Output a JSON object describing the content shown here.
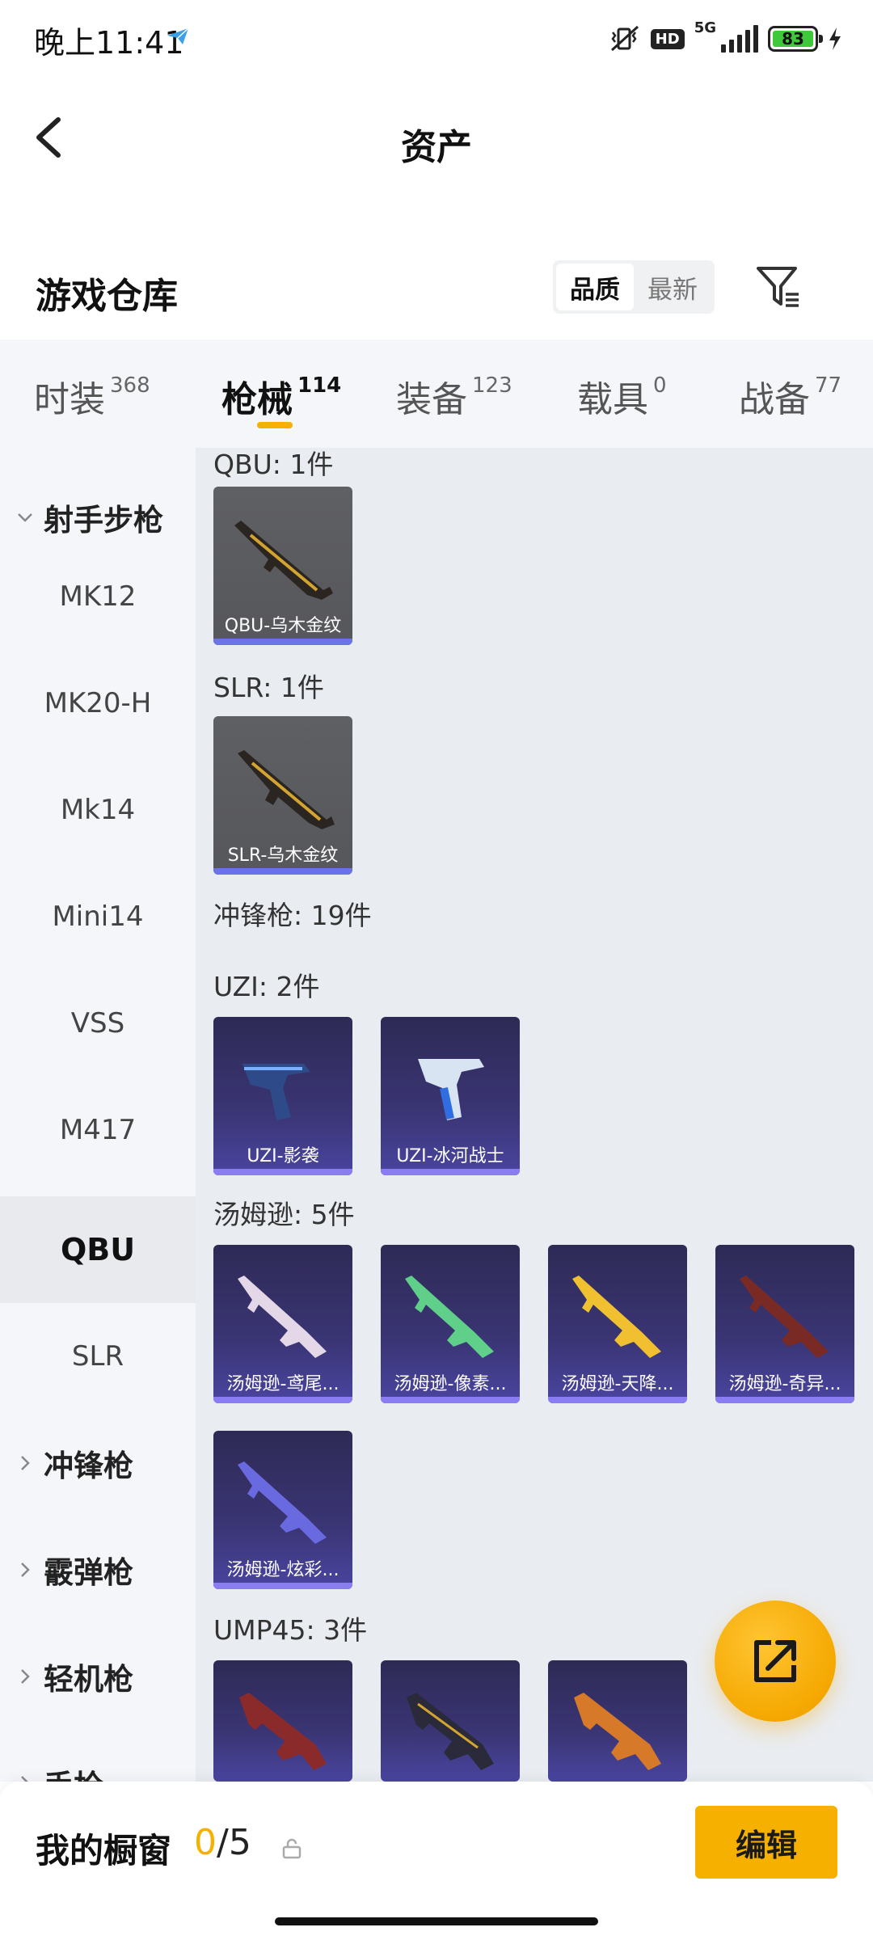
{
  "status": {
    "time": "晚上11:41",
    "hd": "HD",
    "network": "5G",
    "battery": "83"
  },
  "header": {
    "title": "资产"
  },
  "warehouse": {
    "title": "游戏仓库",
    "sort_quality": "品质",
    "sort_newest": "最新"
  },
  "tabs": [
    {
      "label": "时装",
      "count": "368"
    },
    {
      "label": "枪械",
      "count": "114"
    },
    {
      "label": "装备",
      "count": "123"
    },
    {
      "label": "载具",
      "count": "0"
    },
    {
      "label": "战备",
      "count": "77"
    }
  ],
  "sidebar": {
    "group_open": "射手步枪",
    "items": [
      "MK12",
      "MK20-H",
      "Mk14",
      "Mini14",
      "VSS",
      "M417",
      "QBU",
      "SLR"
    ],
    "groups_closed": [
      "冲锋枪",
      "霰弹枪",
      "轻机枪",
      "手枪"
    ]
  },
  "content": {
    "sections": [
      {
        "title": "QBU: 1件",
        "items": [
          "QBU-乌木金纹"
        ]
      },
      {
        "title": "SLR: 1件",
        "items": [
          "SLR-乌木金纹"
        ]
      },
      {
        "title": "冲锋枪: 19件"
      },
      {
        "title": "UZI: 2件",
        "items": [
          "UZI-影袭",
          "UZI-冰河战士"
        ]
      },
      {
        "title": "汤姆逊: 5件",
        "items": [
          "汤姆逊-鸢尾...",
          "汤姆逊-像素...",
          "汤姆逊-天降...",
          "汤姆逊-奇异...",
          "汤姆逊-炫彩..."
        ]
      },
      {
        "title": "UMP45: 3件"
      }
    ]
  },
  "bottom": {
    "showcase_label": "我的橱窗",
    "showcase_current": "0",
    "showcase_sep": "/",
    "showcase_max": "5",
    "edit_label": "编辑"
  },
  "colors": {
    "accent": "#f5b000",
    "card_bar": "#6b73e8",
    "sidebar_bg": "#f4f6f9",
    "content_bg": "#e9ecf0"
  }
}
